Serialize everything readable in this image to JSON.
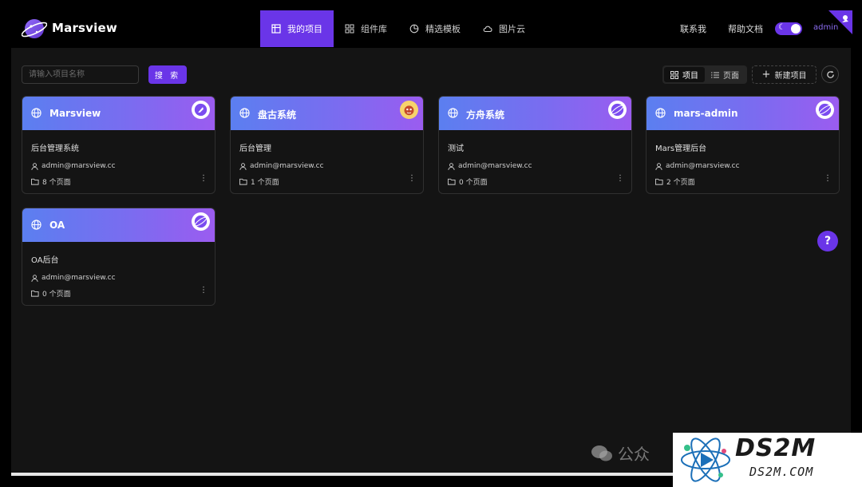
{
  "header": {
    "app_title": "Marsview",
    "nav": [
      {
        "label": "我的项目",
        "icon": "layout-icon",
        "active": true
      },
      {
        "label": "组件库",
        "icon": "grid-icon",
        "active": false
      },
      {
        "label": "精选模板",
        "icon": "pie-icon",
        "active": false
      },
      {
        "label": "图片云",
        "icon": "cloud-icon",
        "active": false
      }
    ],
    "contact": "联系我",
    "help_docs": "帮助文档",
    "user": "admin",
    "accent": "#6a35e8"
  },
  "toolbar": {
    "search_placeholder": "请输入项目名称",
    "search_value": "",
    "search_label": "搜 索",
    "view_project": "项目",
    "view_page": "页面",
    "new_project": "新建项目"
  },
  "projects": [
    {
      "name": "Marsview",
      "desc": "后台管理系统",
      "owner": "admin@marsview.cc",
      "pages": "8 个页面"
    },
    {
      "name": "盘古系统",
      "desc": "后台管理",
      "owner": "admin@marsview.cc",
      "pages": "1 个页面"
    },
    {
      "name": "方舟系统",
      "desc": "测试",
      "owner": "admin@marsview.cc",
      "pages": "0 个页面"
    },
    {
      "name": "mars-admin",
      "desc": "Mars管理后台",
      "owner": "admin@marsview.cc",
      "pages": "2 个页面"
    },
    {
      "name": "OA",
      "desc": "OA后台",
      "owner": "admin@marsview.cc",
      "pages": "0 个页面"
    }
  ],
  "help_button": "?",
  "watermark": {
    "wechat_text": "公众",
    "brand": "DS2M",
    "brand_sub": "DS2M.COM"
  }
}
